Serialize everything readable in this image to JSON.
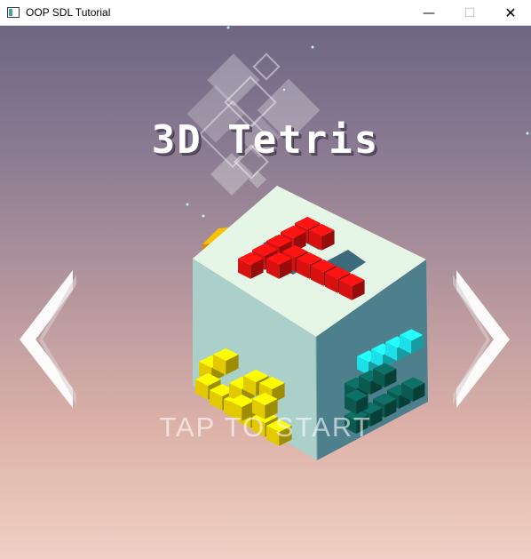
{
  "window": {
    "title": "OOP SDL Tutorial",
    "buttons": {
      "minimize": "—",
      "maximize": "☐",
      "close": "✕"
    }
  },
  "game": {
    "logo": "3D Tetris",
    "prompt": "TAP TO START",
    "nav": {
      "left": "chevron-left-icon",
      "right": "chevron-right-icon"
    },
    "colors": {
      "red": "#d81010",
      "yellow": "#e3c900",
      "cyan": "#1ee0e8",
      "teal": "#0b5a52",
      "orange": "#f0a500",
      "cube_top": "#e6f6e6",
      "cube_left": "#a9cfc8",
      "cube_right": "#4f7f8c"
    }
  }
}
